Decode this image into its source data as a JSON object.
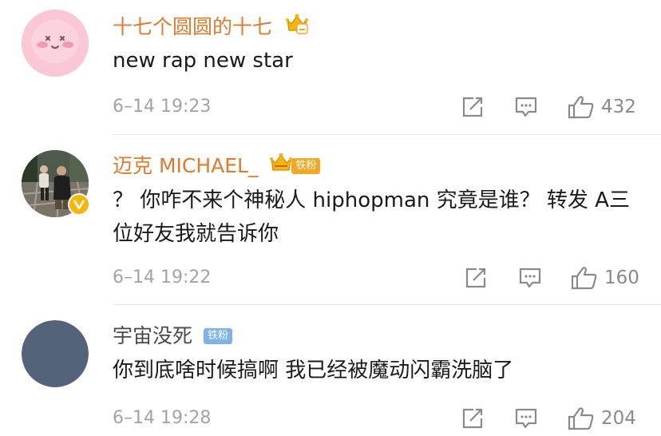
{
  "colors": {
    "name_orange": "#e07a2e",
    "name_gray": "#4a4a4a",
    "fan_badge_orange": "#f5a623",
    "fan_badge_blue": "#7fb2e8",
    "verified": "#f5b60a",
    "meta_gray": "#a3a3a3"
  },
  "comments": [
    {
      "username": "十七个圆圆的十七",
      "text": "new rap new star",
      "timestamp": "6–14 19:23",
      "like_count": "432",
      "avatar": "pink-round-cartoon-avatar",
      "crown_icon": "crown-icon"
    },
    {
      "username": "迈克 MICHAEL_",
      "fan_badge": "铁粉",
      "text": "？ 你咋不来个神秘人 hiphopman 究竟是谁？ 转发 A三位好友我就告诉你",
      "timestamp": "6–14 19:22",
      "like_count": "160",
      "avatar": "photo-avatar",
      "verified_icon": "verified-badge-icon"
    },
    {
      "username": "宇宙没死",
      "fan_badge": "铁粉",
      "text": "你到底啥时候搞啊 我已经被魔动闪霸洗脑了",
      "timestamp": "6–14 19:28",
      "like_count": "204",
      "avatar": "slate-blue-avatar"
    }
  ]
}
